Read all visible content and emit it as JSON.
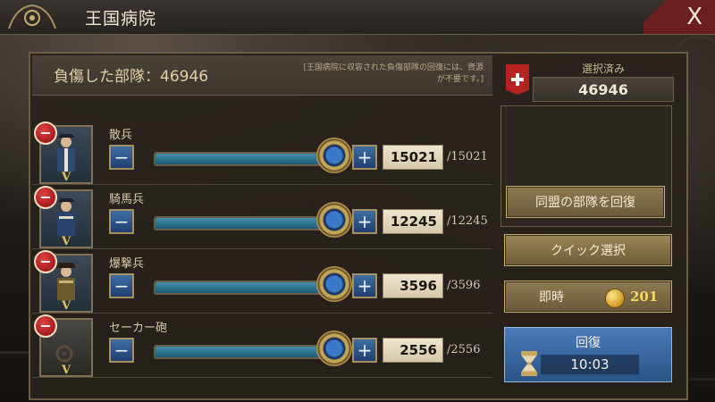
{
  "window": {
    "title": "王国病院",
    "close_label": "X"
  },
  "header": {
    "wounded_label": "負傷した部隊：46946",
    "note": "[王国病院に収容された負傷部隊の回復には、資源が不要です。]"
  },
  "units": [
    {
      "name": "散兵",
      "value": "15021",
      "max": "/15021",
      "rank": "V",
      "fill": 1.0
    },
    {
      "name": "騎馬兵",
      "value": "12245",
      "max": "/12245",
      "rank": "V",
      "fill": 1.0
    },
    {
      "name": "爆撃兵",
      "value": "3596",
      "max": "/3596",
      "rank": "V",
      "fill": 1.0
    },
    {
      "name": "セーカー砲",
      "value": "2556",
      "max": "/2556",
      "rank": "V",
      "fill": 1.0
    }
  ],
  "controls": {
    "minus": "−",
    "plus": "+"
  },
  "sidebar": {
    "selected_label": "選択済み",
    "selected_value": "46946",
    "ally_button": "同盟の部隊を回復",
    "quick_button": "クイック選択",
    "instant_label": "即時",
    "instant_cost": "201",
    "heal_label": "回復",
    "heal_time": "10:03"
  },
  "colors": {
    "accent_gold": "#c8ae70",
    "heal_blue": "#3a6aa8",
    "close_red": "#6b1e1e",
    "badge_red": "#c02020"
  }
}
